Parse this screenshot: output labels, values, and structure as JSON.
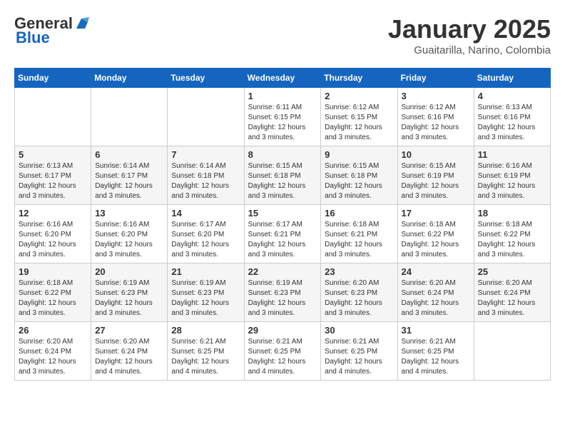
{
  "header": {
    "logo_line1": "General",
    "logo_line2": "Blue",
    "month": "January 2025",
    "location": "Guaitarilla, Narino, Colombia"
  },
  "weekdays": [
    "Sunday",
    "Monday",
    "Tuesday",
    "Wednesday",
    "Thursday",
    "Friday",
    "Saturday"
  ],
  "weeks": [
    [
      {
        "day": "",
        "content": ""
      },
      {
        "day": "",
        "content": ""
      },
      {
        "day": "",
        "content": ""
      },
      {
        "day": "1",
        "content": "Sunrise: 6:11 AM\nSunset: 6:15 PM\nDaylight: 12 hours and 3 minutes."
      },
      {
        "day": "2",
        "content": "Sunrise: 6:12 AM\nSunset: 6:15 PM\nDaylight: 12 hours and 3 minutes."
      },
      {
        "day": "3",
        "content": "Sunrise: 6:12 AM\nSunset: 6:16 PM\nDaylight: 12 hours and 3 minutes."
      },
      {
        "day": "4",
        "content": "Sunrise: 6:13 AM\nSunset: 6:16 PM\nDaylight: 12 hours and 3 minutes."
      }
    ],
    [
      {
        "day": "5",
        "content": "Sunrise: 6:13 AM\nSunset: 6:17 PM\nDaylight: 12 hours and 3 minutes."
      },
      {
        "day": "6",
        "content": "Sunrise: 6:14 AM\nSunset: 6:17 PM\nDaylight: 12 hours and 3 minutes."
      },
      {
        "day": "7",
        "content": "Sunrise: 6:14 AM\nSunset: 6:18 PM\nDaylight: 12 hours and 3 minutes."
      },
      {
        "day": "8",
        "content": "Sunrise: 6:15 AM\nSunset: 6:18 PM\nDaylight: 12 hours and 3 minutes."
      },
      {
        "day": "9",
        "content": "Sunrise: 6:15 AM\nSunset: 6:18 PM\nDaylight: 12 hours and 3 minutes."
      },
      {
        "day": "10",
        "content": "Sunrise: 6:15 AM\nSunset: 6:19 PM\nDaylight: 12 hours and 3 minutes."
      },
      {
        "day": "11",
        "content": "Sunrise: 6:16 AM\nSunset: 6:19 PM\nDaylight: 12 hours and 3 minutes."
      }
    ],
    [
      {
        "day": "12",
        "content": "Sunrise: 6:16 AM\nSunset: 6:20 PM\nDaylight: 12 hours and 3 minutes."
      },
      {
        "day": "13",
        "content": "Sunrise: 6:16 AM\nSunset: 6:20 PM\nDaylight: 12 hours and 3 minutes."
      },
      {
        "day": "14",
        "content": "Sunrise: 6:17 AM\nSunset: 6:20 PM\nDaylight: 12 hours and 3 minutes."
      },
      {
        "day": "15",
        "content": "Sunrise: 6:17 AM\nSunset: 6:21 PM\nDaylight: 12 hours and 3 minutes."
      },
      {
        "day": "16",
        "content": "Sunrise: 6:18 AM\nSunset: 6:21 PM\nDaylight: 12 hours and 3 minutes."
      },
      {
        "day": "17",
        "content": "Sunrise: 6:18 AM\nSunset: 6:22 PM\nDaylight: 12 hours and 3 minutes."
      },
      {
        "day": "18",
        "content": "Sunrise: 6:18 AM\nSunset: 6:22 PM\nDaylight: 12 hours and 3 minutes."
      }
    ],
    [
      {
        "day": "19",
        "content": "Sunrise: 6:18 AM\nSunset: 6:22 PM\nDaylight: 12 hours and 3 minutes."
      },
      {
        "day": "20",
        "content": "Sunrise: 6:19 AM\nSunset: 6:23 PM\nDaylight: 12 hours and 3 minutes."
      },
      {
        "day": "21",
        "content": "Sunrise: 6:19 AM\nSunset: 6:23 PM\nDaylight: 12 hours and 3 minutes."
      },
      {
        "day": "22",
        "content": "Sunrise: 6:19 AM\nSunset: 6:23 PM\nDaylight: 12 hours and 3 minutes."
      },
      {
        "day": "23",
        "content": "Sunrise: 6:20 AM\nSunset: 6:23 PM\nDaylight: 12 hours and 3 minutes."
      },
      {
        "day": "24",
        "content": "Sunrise: 6:20 AM\nSunset: 6:24 PM\nDaylight: 12 hours and 3 minutes."
      },
      {
        "day": "25",
        "content": "Sunrise: 6:20 AM\nSunset: 6:24 PM\nDaylight: 12 hours and 3 minutes."
      }
    ],
    [
      {
        "day": "26",
        "content": "Sunrise: 6:20 AM\nSunset: 6:24 PM\nDaylight: 12 hours and 3 minutes."
      },
      {
        "day": "27",
        "content": "Sunrise: 6:20 AM\nSunset: 6:24 PM\nDaylight: 12 hours and 4 minutes."
      },
      {
        "day": "28",
        "content": "Sunrise: 6:21 AM\nSunset: 6:25 PM\nDaylight: 12 hours and 4 minutes."
      },
      {
        "day": "29",
        "content": "Sunrise: 6:21 AM\nSunset: 6:25 PM\nDaylight: 12 hours and 4 minutes."
      },
      {
        "day": "30",
        "content": "Sunrise: 6:21 AM\nSunset: 6:25 PM\nDaylight: 12 hours and 4 minutes."
      },
      {
        "day": "31",
        "content": "Sunrise: 6:21 AM\nSunset: 6:25 PM\nDaylight: 12 hours and 4 minutes."
      },
      {
        "day": "",
        "content": ""
      }
    ]
  ]
}
